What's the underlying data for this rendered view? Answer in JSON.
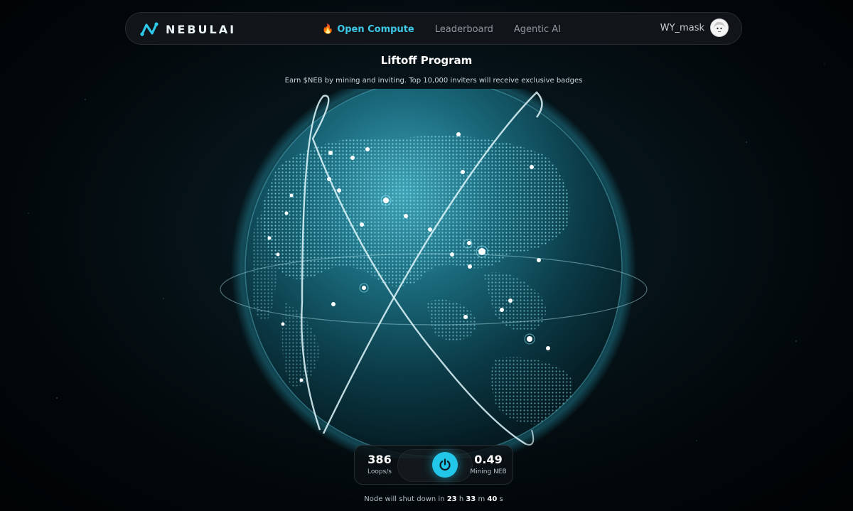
{
  "brand": {
    "name": "NEBULAI"
  },
  "nav": {
    "links": [
      {
        "label": "Open Compute",
        "active": true,
        "icon": "flame-icon"
      },
      {
        "label": "Leaderboard",
        "active": false
      },
      {
        "label": "Agentic AI",
        "active": false
      }
    ]
  },
  "user": {
    "name": "WY_mask",
    "avatar": "anime-avatar"
  },
  "hero": {
    "title": "Liftoff Program",
    "subtitle": "Earn $NEB by mining and inviting. Top 10,000 inviters will receive exclusive badges"
  },
  "stats": {
    "loops_value": "386",
    "loops_label": "Loops/s",
    "mining_value": "0.49",
    "mining_label": "Mining NEB"
  },
  "shutdown": {
    "prefix": "Node will shut down in",
    "hours": "23",
    "h": "h",
    "minutes": "33",
    "m": "m",
    "seconds": "40",
    "s": "s"
  },
  "colors": {
    "accent": "#22c6e8",
    "background": "#03090c",
    "globe": "#0e4f5e"
  }
}
